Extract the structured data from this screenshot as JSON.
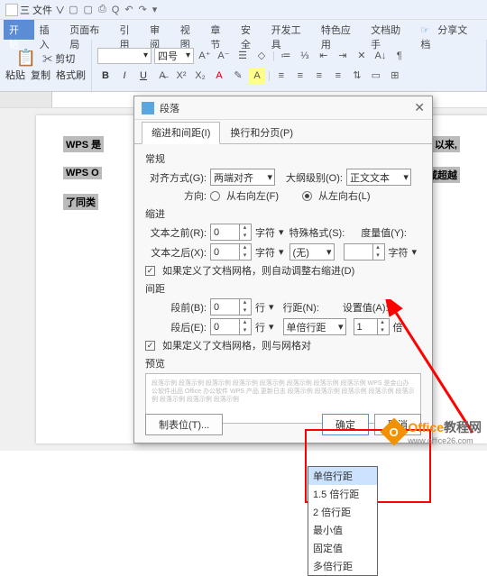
{
  "menubar": {
    "file": "三 文件 ∨",
    "share": "分享文档"
  },
  "tabs": [
    "开始",
    "插入",
    "页面布局",
    "引用",
    "审阅",
    "视图",
    "章节",
    "安全",
    "开发工具",
    "特色应用",
    "文档助手"
  ],
  "ribbon": {
    "paste": "粘贴",
    "copy": "复制",
    "fmt": "格式刷",
    "cut": "剪切",
    "font_size": "四号"
  },
  "bg": {
    "l1": "WPS 是",
    "l1b": "以来,",
    "l2": "WPS O",
    "l2b": "顿域超越",
    "l3": "了同类"
  },
  "dialog": {
    "title": "段落",
    "tab1": "缩进和间距(I)",
    "tab2": "换行和分页(P)",
    "sec_general": "常规",
    "align_lbl": "对齐方式(G):",
    "align_val": "两端对齐",
    "outline_lbl": "大纲级别(O):",
    "outline_val": "正文文本",
    "dir_lbl": "方向:",
    "dir_rtl": "从右向左(F)",
    "dir_ltr": "从左向右(L)",
    "sec_indent": "缩进",
    "before_text": "文本之前(R):",
    "after_text": "文本之后(X):",
    "char_unit": "字符",
    "special": "特殊格式(S):",
    "measure": "度量值(Y):",
    "none": "(无)",
    "zero": "0",
    "chk_grid_indent": "如果定义了文档网格，则自动调整右缩进(D)",
    "sec_spacing": "间距",
    "space_before": "段前(B):",
    "space_after": "段后(E):",
    "line_unit": "行",
    "line_spacing": "行距(N):",
    "set_value": "设置值(A):",
    "single": "单倍行距",
    "val1": "1",
    "times": "倍",
    "chk_grid_space": "如果定义了文档网格，则与网格对",
    "sec_preview": "预览",
    "tabstops": "制表位(T)...",
    "ok": "确定",
    "cancel": "取消"
  },
  "dropdown": [
    "单倍行距",
    "1.5 倍行距",
    "2 倍行距",
    "最小值",
    "固定值",
    "多倍行距"
  ],
  "preview_text": "段落示例 段落示例 段落示例 段落示例 段落示例 段落示例 段落示例 段落示例\nWPS 是金山办公软件出品 Office 办公软件 WPS 产品 更新日志\n段落示例 段落示例 段落示例 段落示例 段落示例 段落示例 段落示例 段落示例",
  "watermark": {
    "brand": "Office",
    "suffix": "教程网",
    "url": "www.office26.com"
  }
}
